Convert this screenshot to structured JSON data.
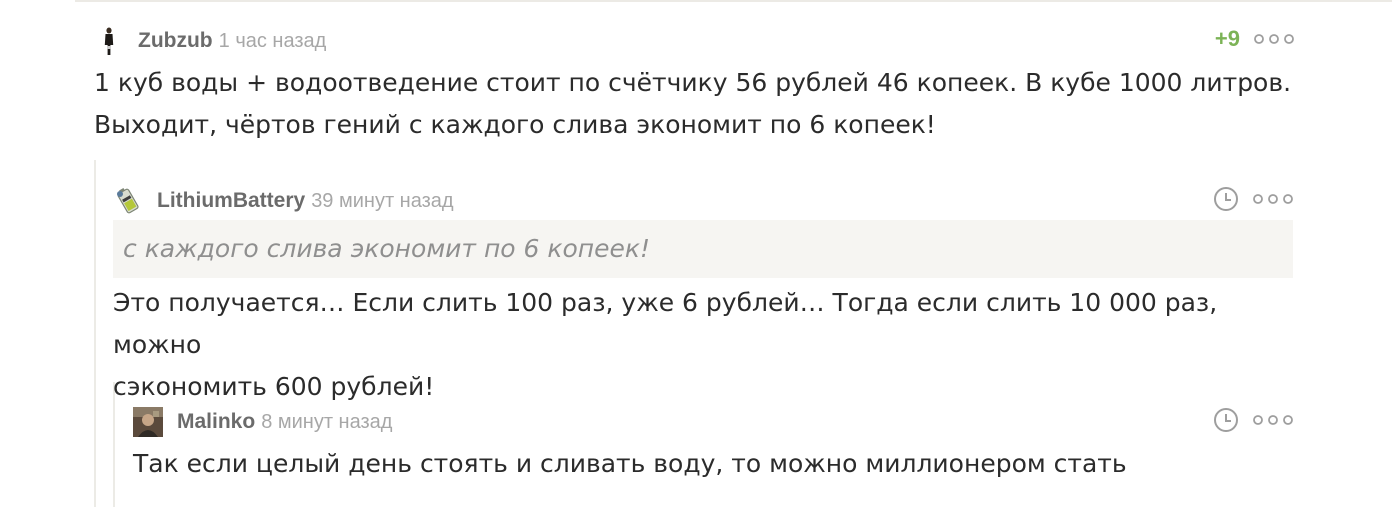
{
  "comments": [
    {
      "author": "Zubzub",
      "time": "1 час назад",
      "rating": "+9",
      "text_lines": [
        "1 куб воды + водоотведение стоит по счётчику 56 рублей 46 копеек. В кубе 1000 литров.",
        "Выходит, чёртов гений с каждого слива экономит по 6 копеек!"
      ],
      "avatar_icon": "person-silhouette-icon",
      "more_icon": "more-dots-icon"
    },
    {
      "author": "LithiumBattery",
      "time": "39 минут назад",
      "quote": "с каждого слива экономит по 6 копеек!",
      "text_lines": [
        "Это получается… Если слить 100 раз, уже 6 рублей… Тогда если слить 10 000 раз, можно",
        "сэкономить 600 рублей!"
      ],
      "avatar_icon": "battery-avatar-icon",
      "clock_icon": "clock-icon",
      "more_icon": "more-dots-icon"
    },
    {
      "author": "Malinko",
      "time": "8 минут назад",
      "text_lines": [
        "Так если целый день стоять и сливать воду, то можно миллионером стать"
      ],
      "avatar_icon": "photo-avatar-icon",
      "clock_icon": "clock-icon",
      "more_icon": "more-dots-icon"
    }
  ],
  "colors": {
    "author": "#6b6b6b",
    "time": "#a7a7a7",
    "rating_positive": "#7cb356",
    "text": "#2b2b2b",
    "quote_bg": "#f6f5f2",
    "quote_text": "#8f8f8f",
    "indent_line": "#ecebe6",
    "icon": "#9e9e9e"
  }
}
